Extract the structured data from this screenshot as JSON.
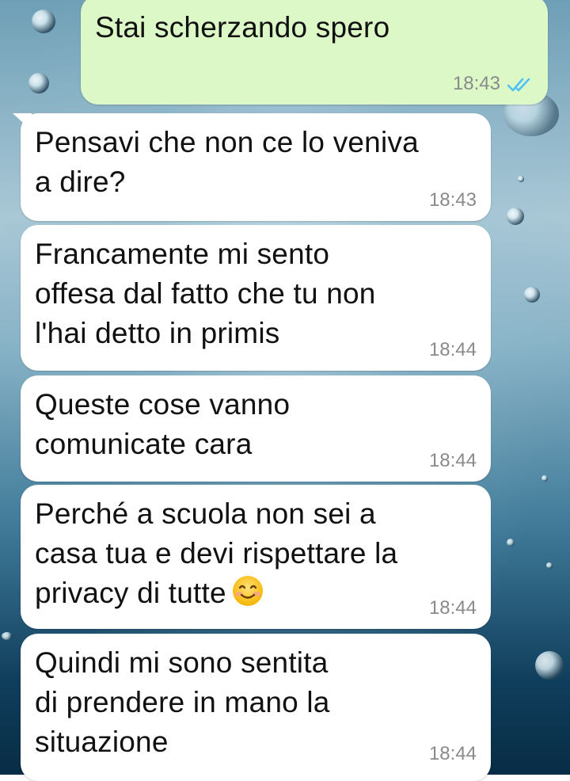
{
  "theme": {
    "outgoing_bubble": "#dcf8c6",
    "incoming_bubble": "#ffffff",
    "timestamp_color": "#8a8a8a",
    "read_ticks_color": "#4fc3f7"
  },
  "messages": [
    {
      "direction": "outgoing",
      "text": "Stai scherzando spero",
      "time": "18:43",
      "status_icon": "double-check-read-icon"
    },
    {
      "direction": "incoming",
      "text": "Pensavi che non ce lo veniva\na dire?",
      "time": "18:43"
    },
    {
      "direction": "incoming",
      "text": "Francamente mi sento\noffesa dal fatto che tu non\nl'hai detto in primis",
      "time": "18:44"
    },
    {
      "direction": "incoming",
      "text": "Queste cose vanno\ncomunicate cara",
      "time": "18:44"
    },
    {
      "direction": "incoming",
      "text": "Perché a scuola non sei a\ncasa tua e devi rispettare la\nprivacy di tutte",
      "emoji": "smiling-face-icon",
      "time": "18:44"
    },
    {
      "direction": "incoming",
      "text": "Quindi mi sono sentita\ndi prendere in mano la\nsituazione",
      "time": "18:44"
    }
  ]
}
